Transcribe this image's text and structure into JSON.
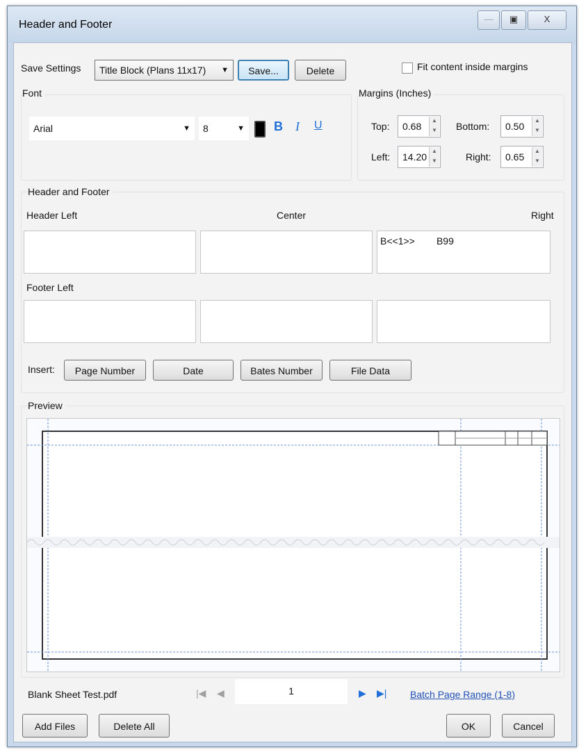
{
  "window": {
    "title": "Header and Footer",
    "minimize_label": "—",
    "maximize_label": "▣",
    "close_label": "X"
  },
  "save_settings": {
    "label": "Save Settings",
    "selected": "Title Block (Plans 11x17)",
    "save_button": "Save...",
    "delete_button": "Delete"
  },
  "fit_content": {
    "label": "Fit content inside margins",
    "checked": false
  },
  "font": {
    "group_label": "Font",
    "family": "Arial",
    "size": "8",
    "bold_label": "B",
    "italic_label": "I",
    "underline_label": "U"
  },
  "margins": {
    "group_label": "Margins (Inches)",
    "top_label": "Top:",
    "top": "0.68",
    "bottom_label": "Bottom:",
    "bottom": "0.50",
    "left_label": "Left:",
    "left": "14.20",
    "right_label": "Right:",
    "right": "0.65"
  },
  "header_footer": {
    "group_label": "Header and Footer",
    "header_left_label": "Header Left",
    "center_label": "Center",
    "right_label": "Right",
    "header_left_text": "",
    "header_center_text": "",
    "header_right_text": "B<<1>>        B99",
    "footer_left_label": "Footer Left",
    "footer_left_text": "",
    "footer_center_text": "",
    "footer_right_text": ""
  },
  "insert": {
    "label": "Insert:",
    "page_number": "Page Number",
    "date": "Date",
    "bates_number": "Bates Number",
    "file_data": "File Data"
  },
  "preview": {
    "label": "Preview"
  },
  "navigation": {
    "file_name": "Blank Sheet Test.pdf",
    "page": "1",
    "batch_link": "Batch Page Range (1-8)"
  },
  "footer_buttons": {
    "add_files": "Add Files",
    "delete_all": "Delete All",
    "ok": "OK",
    "cancel": "Cancel"
  },
  "colors": {
    "accent": "#1f6fd8",
    "link": "#1f4fb5",
    "guide": "#6b8fd6"
  }
}
